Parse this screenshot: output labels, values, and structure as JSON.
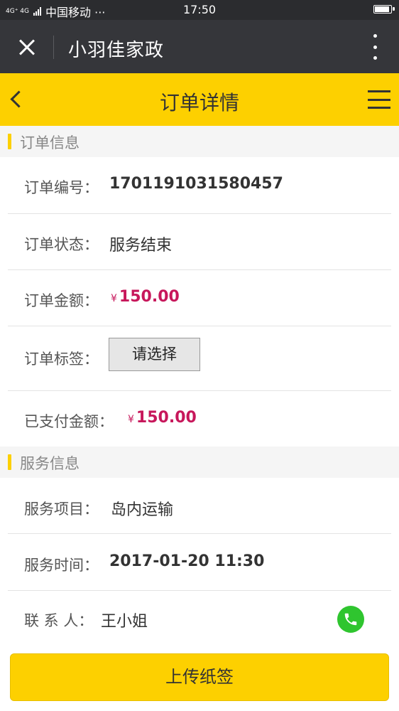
{
  "status_bar": {
    "network": "4G⁺ 4G",
    "carrier": "中国移动 ···",
    "time": "17:50",
    "battery_level": 0.85
  },
  "title_bar": {
    "app_title": "小羽佳家政"
  },
  "header": {
    "title": "订单详情"
  },
  "order_section": {
    "title": "订单信息",
    "rows": {
      "order_no": {
        "label": "订单编号：",
        "value": "1701191031580457"
      },
      "status": {
        "label": "订单状态：",
        "value": "服务结束"
      },
      "amount": {
        "label": "订单金额：",
        "currency": "¥",
        "value": "150.00"
      },
      "tag": {
        "label": "订单标签：",
        "placeholder": "请选择"
      },
      "paid": {
        "label": "已支付金额：",
        "currency": "¥",
        "value": "150.00"
      }
    }
  },
  "service_section": {
    "title": "服务信息",
    "rows": {
      "item": {
        "label": "服务项目：",
        "value": "岛内运输"
      },
      "time": {
        "label": "服务时间：",
        "value": "2017-01-20 11:30"
      },
      "contact": {
        "label": "联 系 人：",
        "value": "王小姐"
      }
    }
  },
  "bottom": {
    "upload_label": "上传纸签"
  },
  "colors": {
    "accent_yellow": "#fdd000",
    "money_red": "#c7175b",
    "phone_green": "#2fc52f",
    "dark_bar": "#35363a"
  }
}
